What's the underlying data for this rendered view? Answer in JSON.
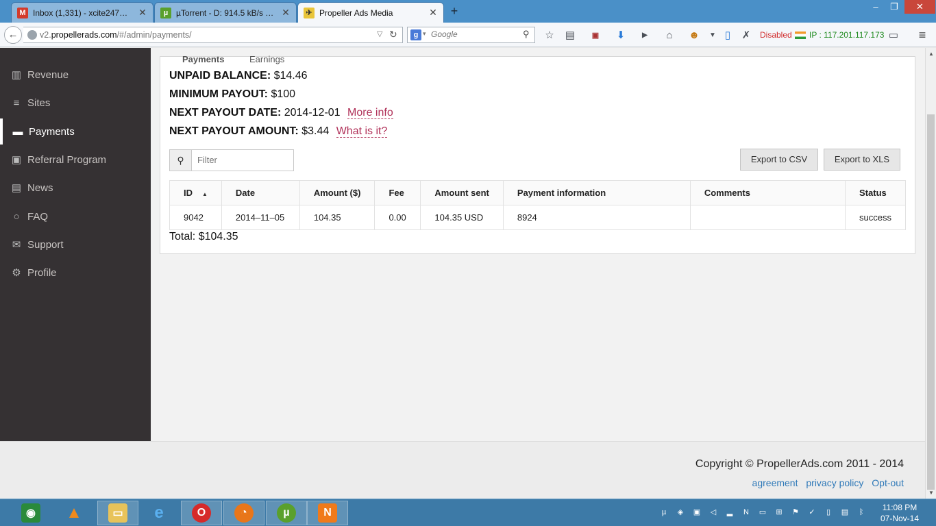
{
  "browser": {
    "tabs": [
      {
        "title": "Inbox (1,331) - xcite247@g...",
        "icon": "gmail-icon"
      },
      {
        "title": "µTorrent - D: 914.5 kB/s U: ...",
        "icon": "utorrent-icon"
      },
      {
        "title": "Propeller Ads Media",
        "icon": "propeller-icon"
      }
    ],
    "new_tab": "+",
    "url_prefix": "v2.",
    "url_domain": "propellerads.com",
    "url_path": "/#/admin/payments/",
    "search_placeholder": "Google",
    "disabled_label": "Disabled",
    "ip_label": "IP : 117.201.117.173"
  },
  "sidebar": {
    "items": [
      {
        "label": "Revenue",
        "icon": "bar-chart-icon"
      },
      {
        "label": "Sites",
        "icon": "list-icon"
      },
      {
        "label": "Payments",
        "icon": "credit-card-icon"
      },
      {
        "label": "Referral Program",
        "icon": "money-icon"
      },
      {
        "label": "News",
        "icon": "newspaper-icon"
      },
      {
        "label": "FAQ",
        "icon": "chat-bubble-icon"
      },
      {
        "label": "Support",
        "icon": "envelope-icon"
      },
      {
        "label": "Profile",
        "icon": "gears-icon"
      }
    ],
    "active": "Payments"
  },
  "panel": {
    "tabs": [
      "Payments",
      "Earnings"
    ],
    "unpaid_balance_label": "UNPAID BALANCE:",
    "unpaid_balance_value": "$14.46",
    "minimum_payout_label": "MINIMUM PAYOUT:",
    "minimum_payout_value": "$100",
    "next_payout_date_label": "NEXT PAYOUT DATE:",
    "next_payout_date_value": "2014-12-01",
    "more_info_link": "More info",
    "next_payout_amount_label": "NEXT PAYOUT AMOUNT:",
    "next_payout_amount_value": "$3.44",
    "what_is_it_link": "What is it?",
    "filter_placeholder": "Filter",
    "export_csv": "Export to CSV",
    "export_xls": "Export to XLS",
    "table": {
      "columns": [
        "ID",
        "Date",
        "Amount ($)",
        "Fee",
        "Amount sent",
        "Payment information",
        "Comments",
        "Status"
      ],
      "rows": [
        [
          "9042",
          "2014–11–05",
          "104.35",
          "0.00",
          "104.35 USD",
          "8924",
          "",
          "success"
        ]
      ]
    },
    "total": "Total: $104.35"
  },
  "footer": {
    "copyright": "Copyright © PropellerAds.com 2011 - 2014",
    "links": [
      "agreement",
      "privacy policy",
      "Opt-out"
    ]
  },
  "taskbar": {
    "time": "11:08 PM",
    "date": "07-Nov-14"
  }
}
